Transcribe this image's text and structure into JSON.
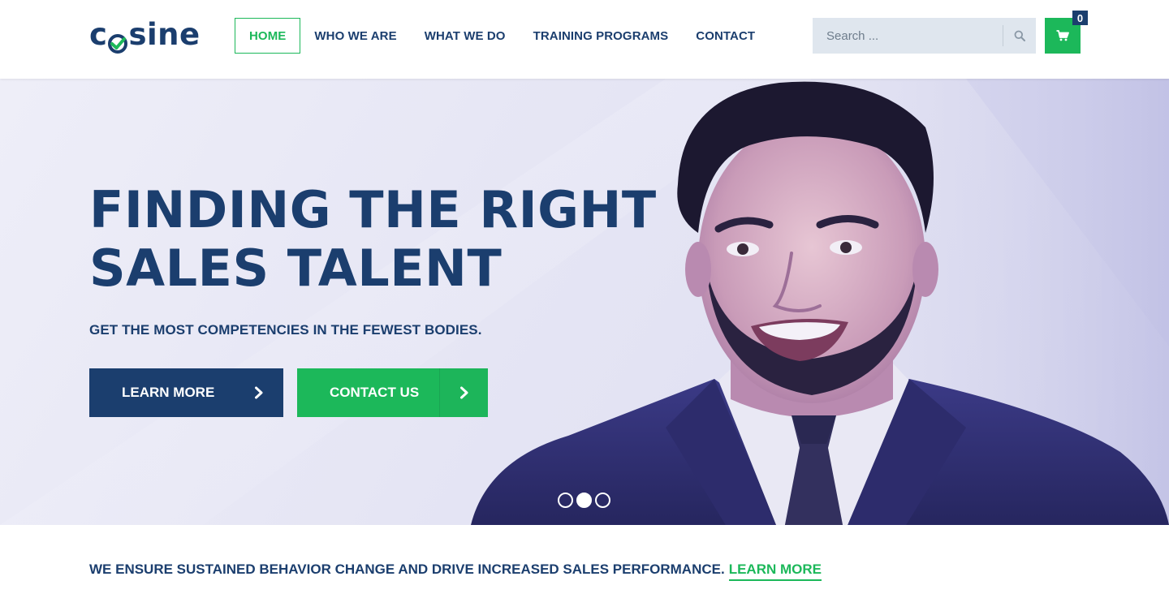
{
  "header": {
    "logo_prefix": "c",
    "logo_suffix": "sine",
    "nav": [
      {
        "label": "HOME",
        "active": true
      },
      {
        "label": "WHO WE ARE",
        "active": false
      },
      {
        "label": "WHAT WE DO",
        "active": false
      },
      {
        "label": "TRAINING PROGRAMS",
        "active": false
      },
      {
        "label": "CONTACT",
        "active": false
      }
    ],
    "search": {
      "placeholder": "Search ...",
      "icon": "search-icon"
    },
    "cart": {
      "icon": "cart-icon",
      "count": "0"
    }
  },
  "hero": {
    "headline_line1": "FINDING THE RIGHT",
    "headline_line2": "SALES TALENT",
    "subheadline": "GET THE MOST COMPETENCIES IN THE FEWEST BODIES.",
    "learn_more_label": "LEARN MORE",
    "contact_label": "CONTACT US",
    "arrow_icon": "chevron-right-icon",
    "slider": {
      "total": 3,
      "active_index": 1
    }
  },
  "tagline": {
    "text": "WE ENSURE SUSTAINED BEHAVIOR CHANGE AND DRIVE INCREASED SALES PERFORMANCE.",
    "link": "LEARN MORE"
  },
  "colors": {
    "navy": "#1b3e6e",
    "green": "#1cb85a",
    "search_bg": "#dfe6ee",
    "hero_bg": "#e5e5f4"
  }
}
